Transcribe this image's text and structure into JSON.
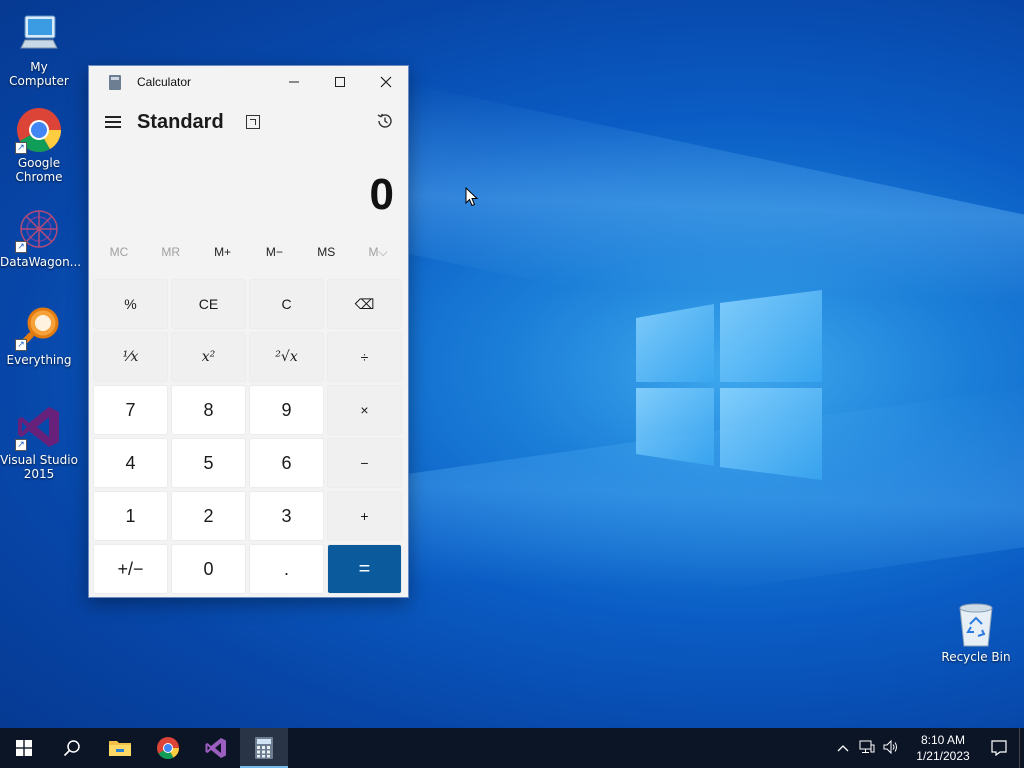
{
  "desktop": {
    "icons": [
      {
        "label": "My Computer"
      },
      {
        "label": "Google Chrome"
      },
      {
        "label": "DataWagon..."
      },
      {
        "label": "Everything"
      },
      {
        "label": "Visual Studio 2015"
      }
    ],
    "recycle_bin": {
      "label": "Recycle Bin"
    }
  },
  "calculator": {
    "window_title": "Calculator",
    "mode": "Standard",
    "display_value": "0",
    "memory_buttons": [
      "MC",
      "MR",
      "M+",
      "M−",
      "MS",
      "M⌵"
    ],
    "keys": [
      "%",
      "CE",
      "C",
      "⌫",
      "¹⁄x",
      "x²",
      "²√x",
      "÷",
      "7",
      "8",
      "9",
      "×",
      "4",
      "5",
      "6",
      "−",
      "1",
      "2",
      "3",
      "+",
      "+/−",
      "0",
      ".",
      "="
    ],
    "accent_color": "#0a5a9c"
  },
  "taskbar": {
    "time": "8:10 AM",
    "date": "1/21/2023",
    "pinned": [
      "start-button",
      "search-icon",
      "file-explorer-icon",
      "chrome-icon",
      "visual-studio-icon",
      "calculator-icon"
    ]
  }
}
